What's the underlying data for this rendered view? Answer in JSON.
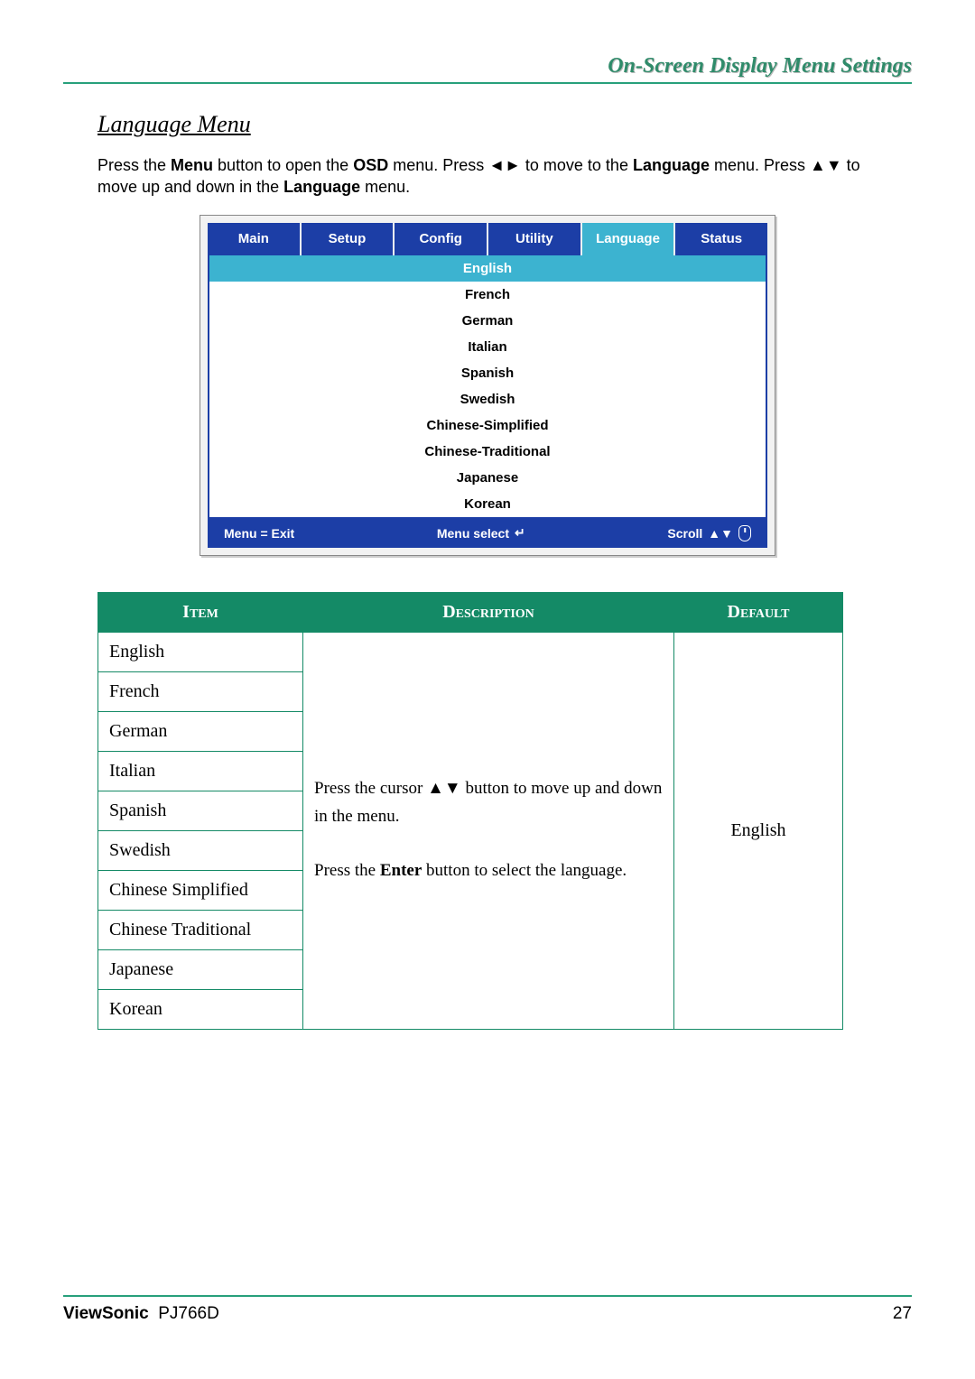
{
  "header": {
    "title": "On-Screen Display Menu Settings"
  },
  "section": {
    "title": "Language Menu"
  },
  "intro": {
    "pre": "Press the ",
    "b1": "Menu",
    "t1": " button to open the ",
    "b2": "OSD",
    "t2": " menu. Press ",
    "arrows1": "◄►",
    "t3": " to move to the ",
    "b3": "Language",
    "t4": " menu. Press ",
    "arrows2": "▲▼",
    "t5": " to move up and down in the ",
    "b4": "Language",
    "t6": " menu."
  },
  "osd": {
    "tabs": [
      "Main",
      "Setup",
      "Config",
      "Utility",
      "Language",
      "Status"
    ],
    "active_index": 4,
    "languages": [
      "English",
      "French",
      "German",
      "Italian",
      "Spanish",
      "Swedish",
      "Chinese-Simplified",
      "Chinese-Traditional",
      "Japanese",
      "Korean"
    ],
    "selected_index": 0,
    "footer": {
      "left": "Menu = Exit",
      "mid": "Menu select",
      "mid_icon": "↵",
      "right": "Scroll",
      "right_icons": "▲▼"
    }
  },
  "table": {
    "headers": {
      "item": "Item",
      "description": "Description",
      "default": "Default"
    },
    "items": [
      "English",
      "French",
      "German",
      "Italian",
      "Spanish",
      "Swedish",
      "Chinese Simplified",
      "Chinese Traditional",
      "Japanese",
      "Korean"
    ],
    "description": {
      "p1a": "Press the cursor ",
      "arrows": "▲▼",
      "p1b": " button to move up and down in the menu.",
      "p2a": "Press the ",
      "b": "Enter",
      "p2b": " button to select the language."
    },
    "default": "English"
  },
  "footer": {
    "brand": "ViewSonic",
    "model": "PJ766D",
    "page": "27"
  }
}
